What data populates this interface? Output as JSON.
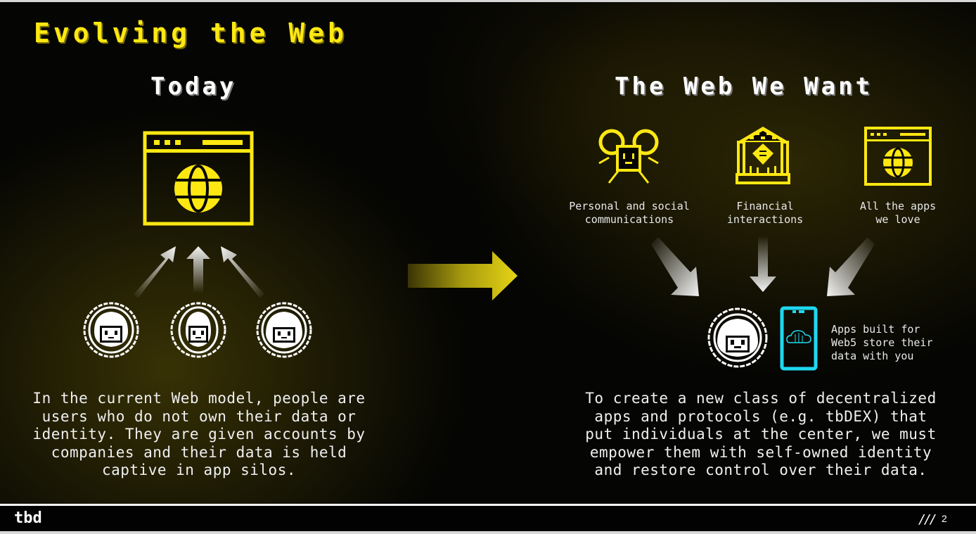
{
  "slide": {
    "title": "Evolving the Web",
    "page_number": "2",
    "logo": "tbd",
    "page_separator": "///",
    "colors": {
      "accent_yellow": "#ffe812",
      "cyan": "#1fd8f0",
      "text": "#f0f0f0"
    }
  },
  "today": {
    "heading": "Today",
    "icons": [
      "browser-globe-icon",
      "user-avatar-icon",
      "user-avatar-icon",
      "user-avatar-icon"
    ],
    "description": "In the current Web model, people are users who do not own their data or identity. They are given accounts by companies and their data is held captive in app silos."
  },
  "transition": {
    "icon": "arrow-right-icon"
  },
  "want": {
    "heading": "The Web We Want",
    "items": [
      {
        "icon": "people-group-icon",
        "label_line1": "Personal and social",
        "label_line2": "communications"
      },
      {
        "icon": "bank-icon",
        "label_line1": "Financial",
        "label_line2": "interactions"
      },
      {
        "icon": "browser-globe-icon",
        "label_line1": "All the apps",
        "label_line2": "we love"
      }
    ],
    "callout_lines": [
      "Apps built for",
      "Web5 store their",
      "data with you"
    ],
    "description": "To create a new class of decentralized apps and protocols (e.g. tbDEX) that put individuals at the center, we must empower them with self-owned identity and restore control over their data."
  }
}
